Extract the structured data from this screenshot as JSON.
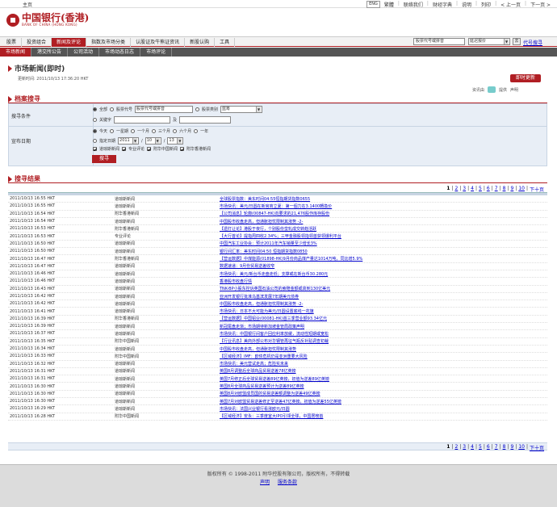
{
  "topbar": {
    "home": "主页",
    "lang": "ENG",
    "links": [
      "繁體",
      "联络我们",
      "财经字典",
      "说明",
      "列印",
      "< 上一页",
      "下一页 >"
    ]
  },
  "header": {
    "bank_name": "中国银行(香港)",
    "bank_name_en": "BANK OF CHINA (HONG KONG)"
  },
  "nav": {
    "items": [
      "股票",
      "投资组合",
      "新闻及评论",
      "指数及市场分类",
      "认股证及牛熊证资讯",
      "新股认购",
      "工具"
    ],
    "active": 2,
    "search_value": "股票代号或拼音",
    "search_select": "延迟报价",
    "go": "去",
    "code_search": "代号搜寻"
  },
  "subnav": {
    "items": [
      "市场新闻",
      "港交所公告",
      "公司活动",
      "市场动态日志",
      "市场评论"
    ],
    "active": 0
  },
  "page": {
    "title": "市场新闻(即时)",
    "updated": "更新时间: 2011/10/13 17:36:20 HKT",
    "refresh": "即时更新",
    "sponsor_label": "资讯由",
    "sponsor_suffix": "提供",
    "disclaimer": "声明"
  },
  "archive": {
    "title": "档案搜寻",
    "criteria_label": "搜寻条件",
    "all": "全部",
    "stock_code": "股票代号",
    "stock_code_value": "股票代号或拼音",
    "stock_type": "股票类别",
    "stock_type_value": "蓝筹",
    "keyword": "关键字",
    "and": "及",
    "date_label": "宣布日期",
    "periods": [
      "今天",
      "一星期",
      "一个月",
      "三个月",
      "六个月",
      "一年"
    ],
    "specify": "指定日期",
    "year": "2011",
    "month": "10",
    "day": "13",
    "sources": [
      "道琼斯新闻",
      "专业评论",
      "附华中国新闻",
      "附华香港新闻"
    ],
    "search_button": "搜寻"
  },
  "results": {
    "title": "搜寻结果",
    "pages": [
      "1",
      "2",
      "3",
      "4",
      "5",
      "6",
      "7",
      "8",
      "9",
      "10"
    ],
    "next_ten": "下十页",
    "rows": [
      {
        "time": "2011/10/13 16:55 HKT",
        "src": "道琼斯新闻",
        "headline": "全球股票指数：美东时间04:55恒指期货指数0655"
      },
      {
        "time": "2011/10/13 16:55 HKT",
        "src": "道琼斯新闻",
        "headline": "市场快讯：美元/日圆在新官商立夏：第一個力在3.1400轉換价"
      },
      {
        "time": "2011/10/13 16:54 HKT",
        "src": "附华香港新闻",
        "headline": "【公司消息】轮廓(00847-HK)向要求的21,476股作库存股份"
      },
      {
        "time": "2011/10/13 16:54 HKT",
        "src": "道琼斯新闻",
        "headline": "中国股市收盘走高，但通胀担忧限制其涨势 -2-"
      },
      {
        "time": "2011/10/13 16:53 HKT",
        "src": "附华香港新闻",
        "headline": "【遗打让论】港股于夜行，个别股份蛮轧成交转趋活跃"
      },
      {
        "time": "2011/10/13 16:53 HKT",
        "src": "专业评论",
        "headline": "【大行首论】提指周四收2.34%；三甲金融股领指领首获领爆利平台"
      },
      {
        "time": "2011/10/13 16:50 HKT",
        "src": "道琼斯新闻",
        "headline": "中国汽车工业协会：预计2011年汽车销量至少增长3%"
      },
      {
        "time": "2011/10/13 16:50 HKT",
        "src": "道琼斯新闻",
        "headline": "银行间汇率：美东时间04:50 恒指期货指数0850"
      },
      {
        "time": "2011/10/13 16:47 HKT",
        "src": "附华香港新闻",
        "headline": "【营运数据】中煤能源(01898-HK)9月份商品煤产量达1014万吨，同比增5.9%"
      },
      {
        "time": "2011/10/13 16:47 HKT",
        "src": "道琼斯新闻",
        "headline": "数据速递：9月份贸易逆差收窄"
      },
      {
        "time": "2011/10/13 16:46 HKT",
        "src": "道琼斯新闻",
        "headline": "市场快讯：美元/新台币走盘走低；支撑或在新台币30.280元"
      },
      {
        "time": "2011/10/13 16:46 HKT",
        "src": "道琼斯新闻",
        "headline": "香港股市收盘行情"
      },
      {
        "time": "2011/10/13 16:43 HKT",
        "src": "道琼斯新闻",
        "headline": "TNK-BP小股东控诉英国石油公司的索赔金额或高到130亿美元"
      },
      {
        "time": "2011/10/13 16:42 HKT",
        "src": "道琼斯新闻",
        "headline": "亚洲开发银行批准乌基滨发展7年期美元债券"
      },
      {
        "time": "2011/10/13 16:42 HKT",
        "src": "道琼斯新闻",
        "headline": "中国股市收盘走高，但通胀担忧限制其涨势 -2-"
      },
      {
        "time": "2011/10/13 16:41 HKT",
        "src": "道琼斯新闻",
        "headline": "市场快讯：日本不大可能为美元/日圆设置底线一花旗"
      },
      {
        "time": "2011/10/13 16:39 HKT",
        "src": "附华香港新闻",
        "headline": "【营运数据】中国铝业(00081-HK)首三季营业额93.34亿元"
      },
      {
        "time": "2011/10/13 16:39 HKT",
        "src": "道琼斯新闻",
        "headline": "新冠尾盘走渐；市场期待新加坡金管局政策声明"
      },
      {
        "time": "2011/10/13 16:37 HKT",
        "src": "道琼斯新闻",
        "headline": "市场快讯：中国银行间客户回应利率放缓，流动性短期或宽松"
      },
      {
        "time": "2011/10/13 16:35 HKT",
        "src": "附华中国新闻",
        "headline": "【行业讯息】美商外部公布对华钢管再征气瓶反补贴调查初裁"
      },
      {
        "time": "2011/10/13 16:34 HKT",
        "src": "道琼斯新闻",
        "headline": "中国股市收盘走高，但通胀担忧限制其涨势"
      },
      {
        "time": "2011/10/13 16:33 HKT",
        "src": "附华中国新闻",
        "headline": "【区域经济】IMF：欧债危机仍是亚洲重要大风险"
      },
      {
        "time": "2011/10/13 16:32 HKT",
        "src": "道琼斯新闻",
        "headline": "市场快讯：美元营试走高；危险实未来"
      },
      {
        "time": "2011/10/13 16:31 HKT",
        "src": "道琼斯新闻",
        "headline": "英国8月调整后全球商品贸易逆差78亿英镑"
      },
      {
        "time": "2011/10/13 16:31 HKT",
        "src": "道琼斯新闻",
        "headline": "英国7月修正后全球贸易逆差89亿英镑，初值为逆差89亿英镑"
      },
      {
        "time": "2011/10/13 16:30 HKT",
        "src": "道琼斯新闻",
        "headline": "英国8月全球商品贸易逆差预计为逆差89亿英镑"
      },
      {
        "time": "2011/10/13 16:30 HKT",
        "src": "道琼斯新闻",
        "headline": "英国8月对欧盟成员国的贸易逆差额调整为逆差49亿英镑"
      },
      {
        "time": "2011/10/13 16:30 HKT",
        "src": "道琼斯新闻",
        "headline": "英国7月对欧盟贸易逆差修正至逆差47亿英镑，初值为逆差55亿英镑"
      },
      {
        "time": "2011/10/13 16:29 HKT",
        "src": "道琼斯新闻",
        "headline": "市场快讯：法国兴业银行看涨欧元/日圆"
      },
      {
        "time": "2011/10/13 16:28 HKT",
        "src": "附华中国新闻",
        "headline": "【区域经济】安永：三季度室大IPO引领全球，中国居榜首"
      }
    ]
  },
  "footer": {
    "copyright": "版权所有 © 1998-2011 附华控股有限公司，版权所有，不得转载",
    "links": [
      "声明",
      "服务条款"
    ]
  }
}
